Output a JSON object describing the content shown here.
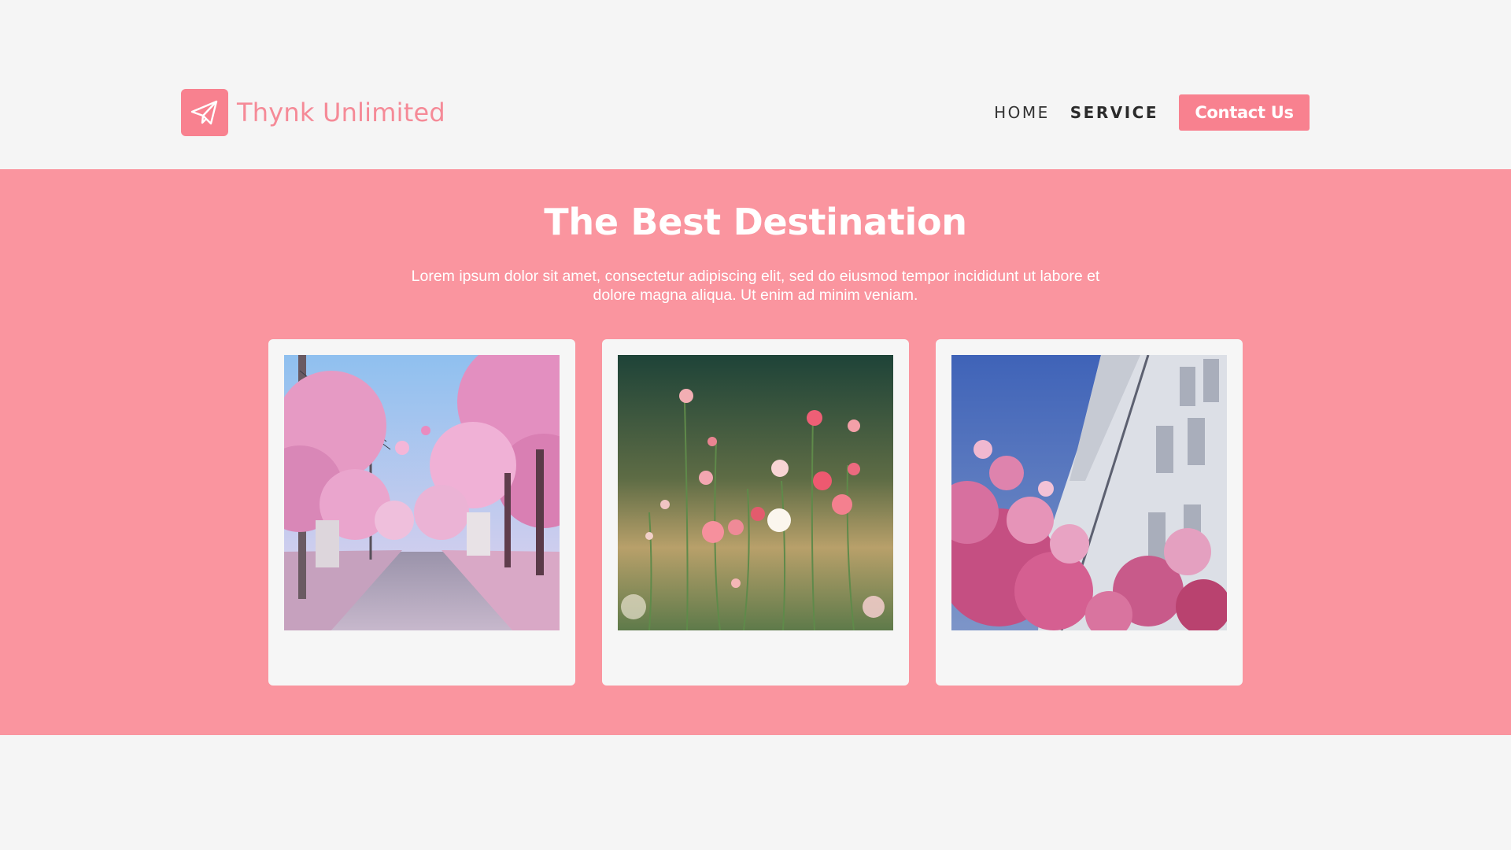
{
  "header": {
    "brand_name": "Thynk Unlimited",
    "logo_icon": "paper-plane-icon",
    "nav": {
      "home_label": "HOME",
      "service_label": "SERVICE",
      "contact_label": "Contact Us"
    }
  },
  "hero": {
    "title": "The Best Destination",
    "description": "Lorem ipsum dolor sit amet, consectetur adipiscing elit, sed do eiusmod tempor incididunt ut labore et dolore magna aliqua. Ut enim ad minim veniam."
  },
  "gallery": {
    "cards": [
      {
        "image": "cherry-blossom-street"
      },
      {
        "image": "wildflower-meadow"
      },
      {
        "image": "magnolia-building"
      }
    ]
  },
  "colors": {
    "accent": "#f8818f",
    "hero_background": "#fa959f",
    "page_background": "#f5f5f5",
    "card_background": "#f6f6f6"
  }
}
